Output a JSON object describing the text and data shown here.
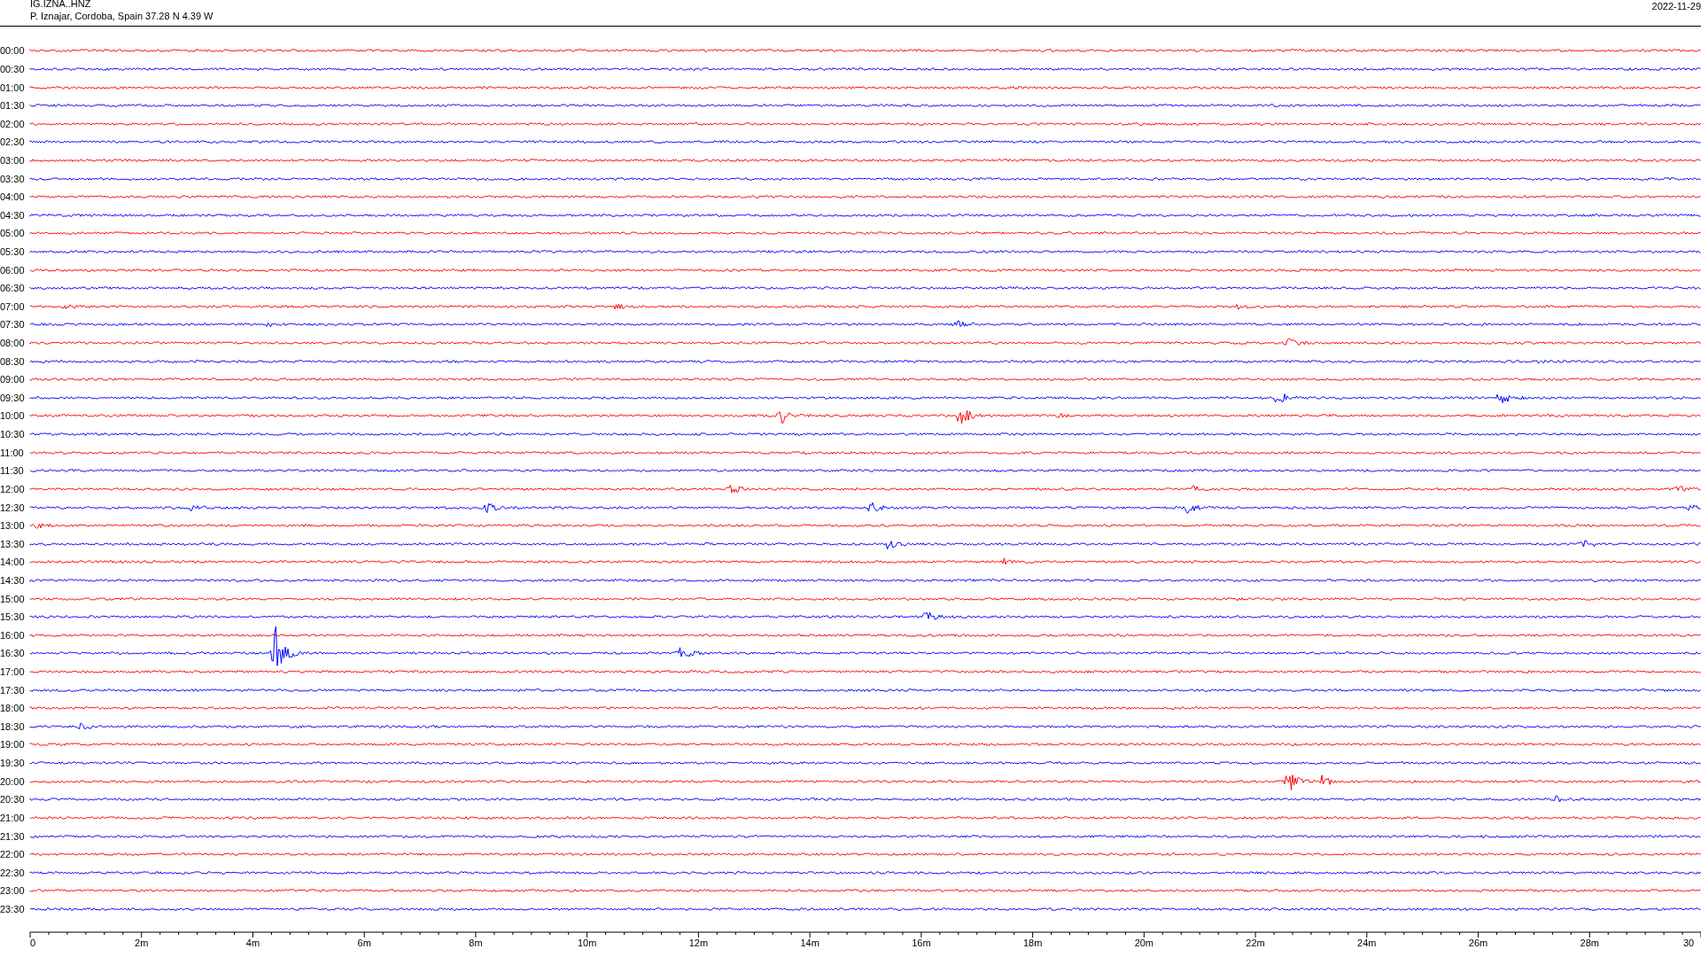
{
  "header": {
    "station": "IG.IZNA..HNZ",
    "location": "P. Iznajar, Cordoba, Spain  37.28 N 4.39 W",
    "date": "2022-11-29"
  },
  "rows": [
    {
      "time": "00:00",
      "color": "#ff0000"
    },
    {
      "time": "00:30",
      "color": "#0000ff"
    },
    {
      "time": "01:00",
      "color": "#ff0000"
    },
    {
      "time": "01:30",
      "color": "#0000ff"
    },
    {
      "time": "02:00",
      "color": "#ff0000"
    },
    {
      "time": "02:30",
      "color": "#0000ff"
    },
    {
      "time": "03:00",
      "color": "#ff0000"
    },
    {
      "time": "03:30",
      "color": "#0000ff"
    },
    {
      "time": "04:00",
      "color": "#ff0000"
    },
    {
      "time": "04:30",
      "color": "#0000ff"
    },
    {
      "time": "05:00",
      "color": "#ff0000"
    },
    {
      "time": "05:30",
      "color": "#0000ff"
    },
    {
      "time": "06:00",
      "color": "#ff0000"
    },
    {
      "time": "06:30",
      "color": "#0000ff"
    },
    {
      "time": "07:00",
      "color": "#ff0000"
    },
    {
      "time": "07:30",
      "color": "#0000ff"
    },
    {
      "time": "08:00",
      "color": "#ff0000"
    },
    {
      "time": "08:30",
      "color": "#0000ff"
    },
    {
      "time": "09:00",
      "color": "#ff0000"
    },
    {
      "time": "09:30",
      "color": "#0000ff"
    },
    {
      "time": "10:00",
      "color": "#ff0000"
    },
    {
      "time": "10:30",
      "color": "#0000ff"
    },
    {
      "time": "11:00",
      "color": "#ff0000"
    },
    {
      "time": "11:30",
      "color": "#0000ff"
    },
    {
      "time": "12:00",
      "color": "#ff0000"
    },
    {
      "time": "12:30",
      "color": "#0000ff"
    },
    {
      "time": "13:00",
      "color": "#ff0000"
    },
    {
      "time": "13:30",
      "color": "#0000ff"
    },
    {
      "time": "14:00",
      "color": "#ff0000"
    },
    {
      "time": "14:30",
      "color": "#0000ff"
    },
    {
      "time": "15:00",
      "color": "#ff0000"
    },
    {
      "time": "15:30",
      "color": "#0000ff"
    },
    {
      "time": "16:00",
      "color": "#ff0000"
    },
    {
      "time": "16:30",
      "color": "#0000ff"
    },
    {
      "time": "17:00",
      "color": "#ff0000"
    },
    {
      "time": "17:30",
      "color": "#0000ff"
    },
    {
      "time": "18:00",
      "color": "#ff0000"
    },
    {
      "time": "18:30",
      "color": "#0000ff"
    },
    {
      "time": "19:00",
      "color": "#ff0000"
    },
    {
      "time": "19:30",
      "color": "#0000ff"
    },
    {
      "time": "20:00",
      "color": "#ff0000"
    },
    {
      "time": "20:30",
      "color": "#0000ff"
    },
    {
      "time": "21:00",
      "color": "#ff0000"
    },
    {
      "time": "21:30",
      "color": "#0000ff"
    },
    {
      "time": "22:00",
      "color": "#ff0000"
    },
    {
      "time": "22:30",
      "color": "#0000ff"
    },
    {
      "time": "23:00",
      "color": "#ff0000"
    },
    {
      "time": "23:30",
      "color": "#0000ff"
    }
  ],
  "axis": {
    "ticks": [
      "0",
      "2m",
      "4m",
      "6m",
      "8m",
      "10m",
      "12m",
      "14m",
      "16m",
      "18m",
      "20m",
      "22m",
      "24m",
      "26m",
      "28m",
      "30"
    ]
  }
}
